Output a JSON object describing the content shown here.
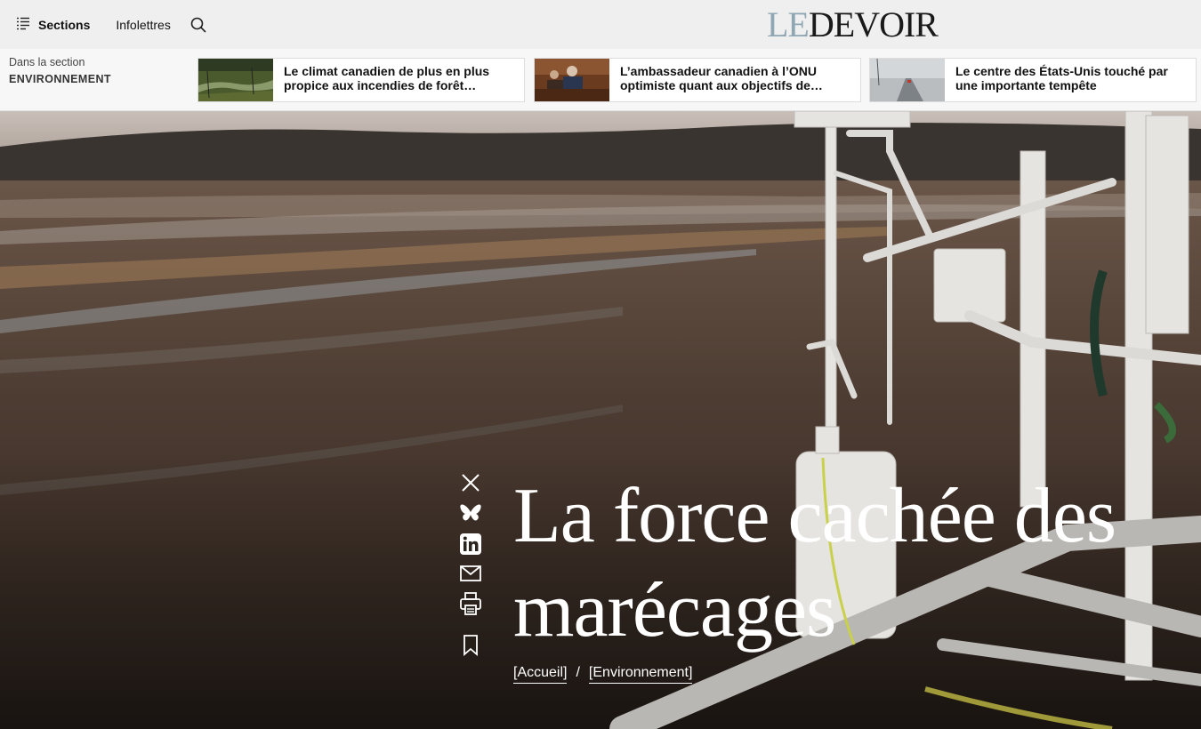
{
  "header": {
    "sections_label": "Sections",
    "newsletters_label": "Infolettres",
    "logo_le": "LE",
    "logo_devoir": "DEVOIR"
  },
  "related": {
    "intro": "Dans la section",
    "section": "ENVIRONNEMENT",
    "articles": [
      {
        "title": "Le climat canadien de plus en plus propice aux incendies de forêt…"
      },
      {
        "title": "L’ambassadeur canadien à l’ONU optimiste quant aux objectifs de…"
      },
      {
        "title": "Le centre des États-Unis touché par une importante tempête"
      }
    ]
  },
  "article": {
    "headline": "La force cachée des marécages",
    "breadcrumb": [
      "[Accueil]",
      "/",
      "[Environnement]"
    ]
  },
  "icons": [
    "sections-menu-icon",
    "search-icon",
    "x-icon",
    "bluesky-icon",
    "linkedin-icon",
    "email-icon",
    "print-icon",
    "bookmark-icon"
  ]
}
